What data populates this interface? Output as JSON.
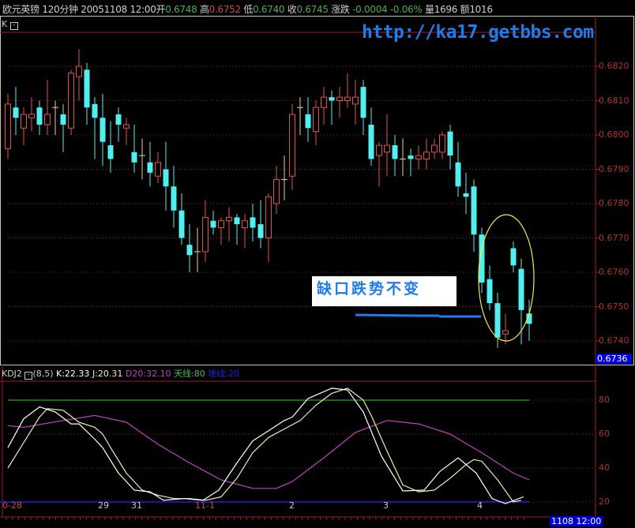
{
  "header": {
    "instrument": "欧元英镑",
    "period": "120分钟",
    "datetime": "20051108 12:00",
    "open_label": "开",
    "open": "0.6748",
    "high_label": "高",
    "high": "0.6752",
    "low_label": "低",
    "low": "0.6740",
    "close_label": "收",
    "close": "0.6745",
    "change_label": "涨跌",
    "change": "-0.0004",
    "change_pct": "-0.06%",
    "volume_label": "量",
    "volume": "1696",
    "amount_label": "额",
    "amount": "1016"
  },
  "watermark": "http://ka17.getbbs.com",
  "main_panel": {
    "label": "K",
    "collapse_icon": "minus-box-icon",
    "current_price": "0.6736",
    "annotation": "缺口跌势不变",
    "price_axis": [
      "0.6820",
      "0.6810",
      "0.6800",
      "0.6790",
      "0.6780",
      "0.6770",
      "0.6760",
      "0.6750",
      "0.6740"
    ]
  },
  "kdj_panel": {
    "name": "KDJ2",
    "params": "(8,5)",
    "k": "K:22.33",
    "j": "J:20.31",
    "d20": "D20:32.10",
    "sky": "天线:80",
    "ground": "地线:20",
    "axis": [
      "80",
      "60",
      "40",
      "20"
    ]
  },
  "time_axis": {
    "labels": [
      "0-28",
      "29",
      "31",
      "11-1",
      "2",
      "3",
      "4"
    ],
    "cursor": "1108 12:00"
  },
  "colors": {
    "up": "#e05050",
    "down": "#50f0f0",
    "doji": "#f0d090",
    "k": "#ffffff",
    "j": "#f0f0a0",
    "d20": "#c040c0",
    "sky": "#40c040",
    "ground": "#2020e0",
    "axis": "#a02020"
  },
  "chart_data": {
    "type": "candlestick",
    "ohlc": [
      [
        0.6796,
        0.6812,
        0.6793,
        0.6809
      ],
      [
        0.6808,
        0.6814,
        0.68,
        0.6805
      ],
      [
        0.6802,
        0.6808,
        0.6797,
        0.6806
      ],
      [
        0.6805,
        0.6811,
        0.6801,
        0.6806
      ],
      [
        0.6808,
        0.681,
        0.68,
        0.6803
      ],
      [
        0.6803,
        0.6816,
        0.68,
        0.6806
      ],
      [
        0.6808,
        0.681,
        0.68,
        0.6808
      ],
      [
        0.6806,
        0.6809,
        0.6795,
        0.6803
      ],
      [
        0.6802,
        0.6819,
        0.68,
        0.6818
      ],
      [
        0.6817,
        0.6825,
        0.681,
        0.682
      ],
      [
        0.6819,
        0.6821,
        0.6803,
        0.6808
      ],
      [
        0.6809,
        0.6811,
        0.6793,
        0.6805
      ],
      [
        0.6805,
        0.6812,
        0.6791,
        0.6798
      ],
      [
        0.6797,
        0.6804,
        0.6789,
        0.6793
      ],
      [
        0.6806,
        0.6808,
        0.6798,
        0.6803
      ],
      [
        0.6802,
        0.6805,
        0.6797,
        0.6803
      ],
      [
        0.6795,
        0.6803,
        0.6789,
        0.6792
      ],
      [
        0.6794,
        0.6799,
        0.6787,
        0.6794
      ],
      [
        0.6792,
        0.6798,
        0.6785,
        0.6789
      ],
      [
        0.6788,
        0.6795,
        0.6786,
        0.6792
      ],
      [
        0.679,
        0.6798,
        0.6778,
        0.6785
      ],
      [
        0.6785,
        0.6791,
        0.6773,
        0.6778
      ],
      [
        0.6778,
        0.6783,
        0.6768,
        0.677
      ],
      [
        0.6768,
        0.6774,
        0.676,
        0.6765
      ],
      [
        0.6766,
        0.6773,
        0.676,
        0.6766
      ],
      [
        0.6766,
        0.6781,
        0.6763,
        0.6776
      ],
      [
        0.6775,
        0.6778,
        0.6771,
        0.6773
      ],
      [
        0.6773,
        0.6776,
        0.6768,
        0.6775
      ],
      [
        0.6775,
        0.6779,
        0.6769,
        0.6776
      ],
      [
        0.6776,
        0.6777,
        0.6768,
        0.6774
      ],
      [
        0.6773,
        0.6777,
        0.6767,
        0.6775
      ],
      [
        0.6776,
        0.678,
        0.6769,
        0.6773
      ],
      [
        0.6774,
        0.6781,
        0.6767,
        0.677
      ],
      [
        0.677,
        0.6783,
        0.6763,
        0.6782
      ],
      [
        0.678,
        0.6791,
        0.6777,
        0.6787
      ],
      [
        0.6787,
        0.6794,
        0.6781,
        0.6787
      ],
      [
        0.6788,
        0.6809,
        0.6784,
        0.6806
      ],
      [
        0.6808,
        0.6811,
        0.68,
        0.6808
      ],
      [
        0.6806,
        0.6811,
        0.6798,
        0.6802
      ],
      [
        0.6801,
        0.681,
        0.6797,
        0.6808
      ],
      [
        0.6808,
        0.6814,
        0.6803,
        0.6811
      ],
      [
        0.6811,
        0.6813,
        0.6803,
        0.681
      ],
      [
        0.681,
        0.6814,
        0.6805,
        0.6811
      ],
      [
        0.681,
        0.6818,
        0.6808,
        0.6811
      ],
      [
        0.6809,
        0.6816,
        0.6803,
        0.6811
      ],
      [
        0.6814,
        0.6816,
        0.68,
        0.6805
      ],
      [
        0.6803,
        0.6808,
        0.6791,
        0.6793
      ],
      [
        0.6794,
        0.6798,
        0.6785,
        0.6797
      ],
      [
        0.6795,
        0.6806,
        0.6788,
        0.6797
      ],
      [
        0.6797,
        0.68,
        0.6788,
        0.6793
      ],
      [
        0.6793,
        0.6799,
        0.6788,
        0.6793
      ],
      [
        0.6794,
        0.6796,
        0.6788,
        0.6793
      ],
      [
        0.6793,
        0.6797,
        0.679,
        0.6794
      ],
      [
        0.6793,
        0.6799,
        0.679,
        0.6795
      ],
      [
        0.6795,
        0.6799,
        0.6793,
        0.6797
      ],
      [
        0.6795,
        0.6801,
        0.6793,
        0.68
      ],
      [
        0.6801,
        0.6803,
        0.679,
        0.6794
      ],
      [
        0.6792,
        0.6798,
        0.6782,
        0.6785
      ],
      [
        0.6783,
        0.6789,
        0.6777,
        0.6782
      ],
      [
        0.6785,
        0.6787,
        0.6766,
        0.6771
      ],
      [
        0.6771,
        0.6773,
        0.6754,
        0.6757
      ],
      [
        0.6758,
        0.6762,
        0.6749,
        0.6751
      ],
      [
        0.6751,
        0.6754,
        0.6738,
        0.6741
      ],
      [
        0.6742,
        0.6748,
        0.6739,
        0.6743
      ],
      [
        0.6767,
        0.6769,
        0.676,
        0.6762
      ],
      [
        0.6761,
        0.6764,
        0.6739,
        0.6749
      ],
      [
        0.6748,
        0.6752,
        0.674,
        0.6745
      ]
    ],
    "ylim": [
      0.6736,
      0.6828
    ],
    "kdj": {
      "ylim": [
        15,
        92
      ],
      "k": [
        [
          0,
          52
        ],
        [
          2,
          69
        ],
        [
          4,
          76
        ],
        [
          6,
          73
        ],
        [
          8,
          66
        ],
        [
          9,
          66
        ],
        [
          11,
          57
        ],
        [
          12,
          52
        ],
        [
          14,
          37
        ],
        [
          16,
          27
        ],
        [
          18,
          26
        ],
        [
          19.7,
          21
        ],
        [
          22.3,
          22
        ],
        [
          24.7,
          21
        ],
        [
          26.7,
          27
        ],
        [
          29,
          43
        ],
        [
          31,
          56
        ],
        [
          33,
          62
        ],
        [
          35,
          68
        ],
        [
          36,
          70
        ],
        [
          38,
          81
        ],
        [
          41,
          87
        ],
        [
          43,
          86
        ],
        [
          45,
          73
        ],
        [
          47.3,
          47
        ],
        [
          50,
          26.5
        ],
        [
          52.7,
          27
        ],
        [
          54.7,
          38
        ],
        [
          57,
          46
        ],
        [
          59.3,
          37
        ],
        [
          61.3,
          22
        ],
        [
          63,
          19
        ],
        [
          65.3,
          23
        ]
      ],
      "j": [
        [
          0,
          40
        ],
        [
          2,
          55
        ],
        [
          4,
          70
        ],
        [
          5,
          75
        ],
        [
          7,
          74
        ],
        [
          9,
          67
        ],
        [
          11,
          64
        ],
        [
          12,
          60
        ],
        [
          13,
          52
        ],
        [
          15,
          37
        ],
        [
          17,
          27
        ],
        [
          19,
          24
        ],
        [
          21,
          22
        ],
        [
          23,
          22
        ],
        [
          25,
          21
        ],
        [
          27,
          23
        ],
        [
          29,
          34
        ],
        [
          31,
          49
        ],
        [
          33,
          58
        ],
        [
          35,
          63
        ],
        [
          37,
          68
        ],
        [
          39,
          77
        ],
        [
          41,
          84
        ],
        [
          43,
          87
        ],
        [
          45,
          80
        ],
        [
          46,
          71
        ],
        [
          48,
          50
        ],
        [
          50,
          30
        ],
        [
          52,
          26
        ],
        [
          54,
          27
        ],
        [
          56,
          34
        ],
        [
          58,
          42
        ],
        [
          59,
          45
        ],
        [
          60,
          44
        ],
        [
          62,
          33
        ],
        [
          64,
          20
        ],
        [
          65,
          21
        ]
      ],
      "d20": [
        [
          0,
          65
        ],
        [
          2,
          64
        ],
        [
          7,
          68
        ],
        [
          11,
          71
        ],
        [
          15,
          67
        ],
        [
          19,
          54
        ],
        [
          23,
          43
        ],
        [
          27,
          33
        ],
        [
          31,
          28
        ],
        [
          34,
          28
        ],
        [
          36,
          32
        ],
        [
          40,
          46
        ],
        [
          44,
          61
        ],
        [
          48,
          68
        ],
        [
          52,
          66
        ],
        [
          56,
          60
        ],
        [
          60,
          49
        ],
        [
          64,
          37
        ],
        [
          66,
          33
        ]
      ],
      "sky": 80,
      "ground": 20
    }
  }
}
